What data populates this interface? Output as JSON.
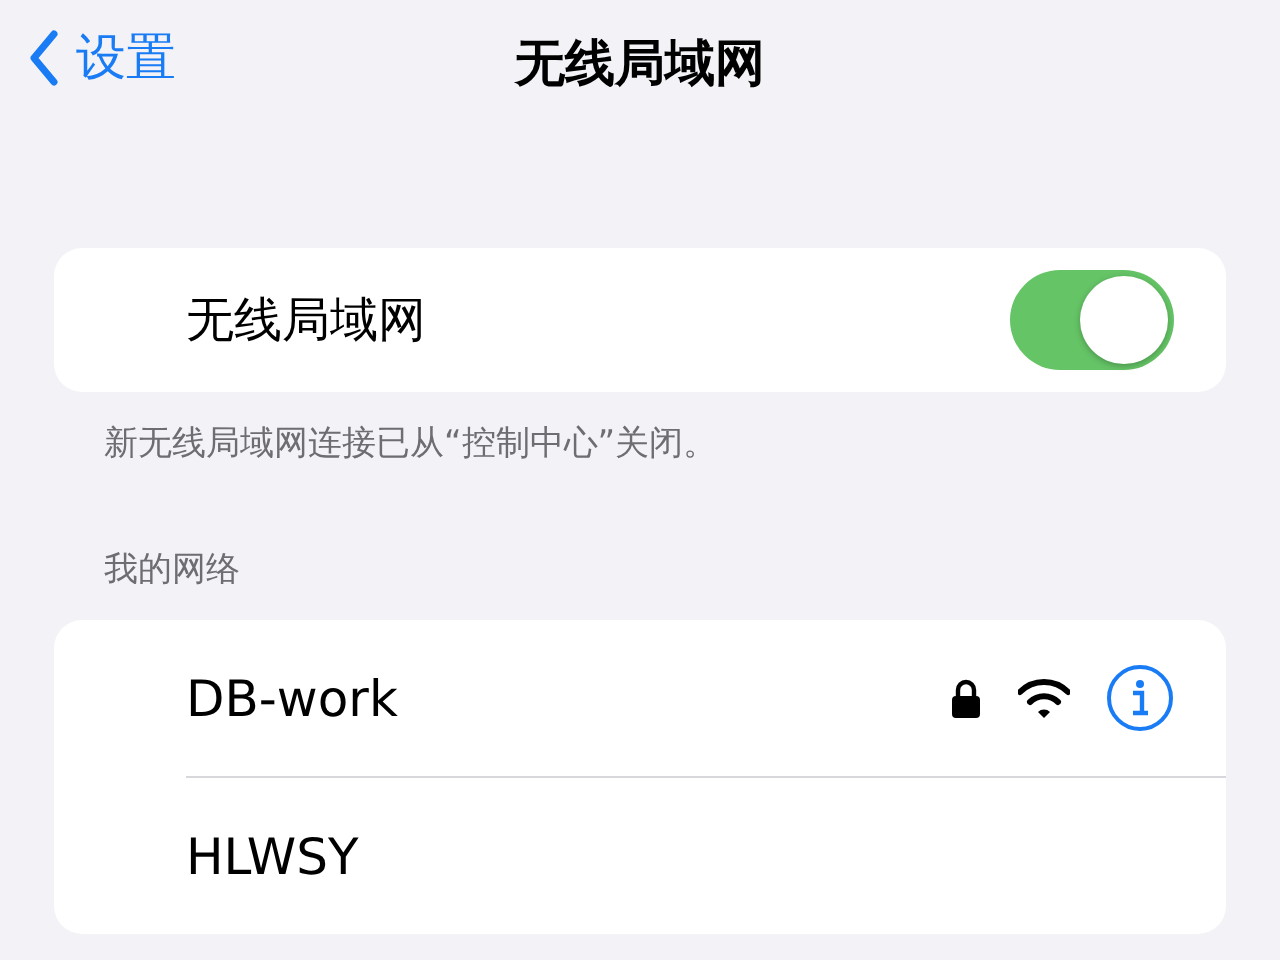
{
  "nav": {
    "back_label": "设置",
    "title": "无线局域网"
  },
  "wifi": {
    "label": "无线局域网",
    "on": true
  },
  "wifi_footer": "新无线局域网连接已从“控制中心”关闭。",
  "networks_header": "我的网络",
  "networks": [
    {
      "name": "DB-work",
      "locked": true,
      "signal": true,
      "info_button": true
    },
    {
      "name": "HLWSY",
      "locked": false,
      "signal": false,
      "info_button": false
    }
  ]
}
